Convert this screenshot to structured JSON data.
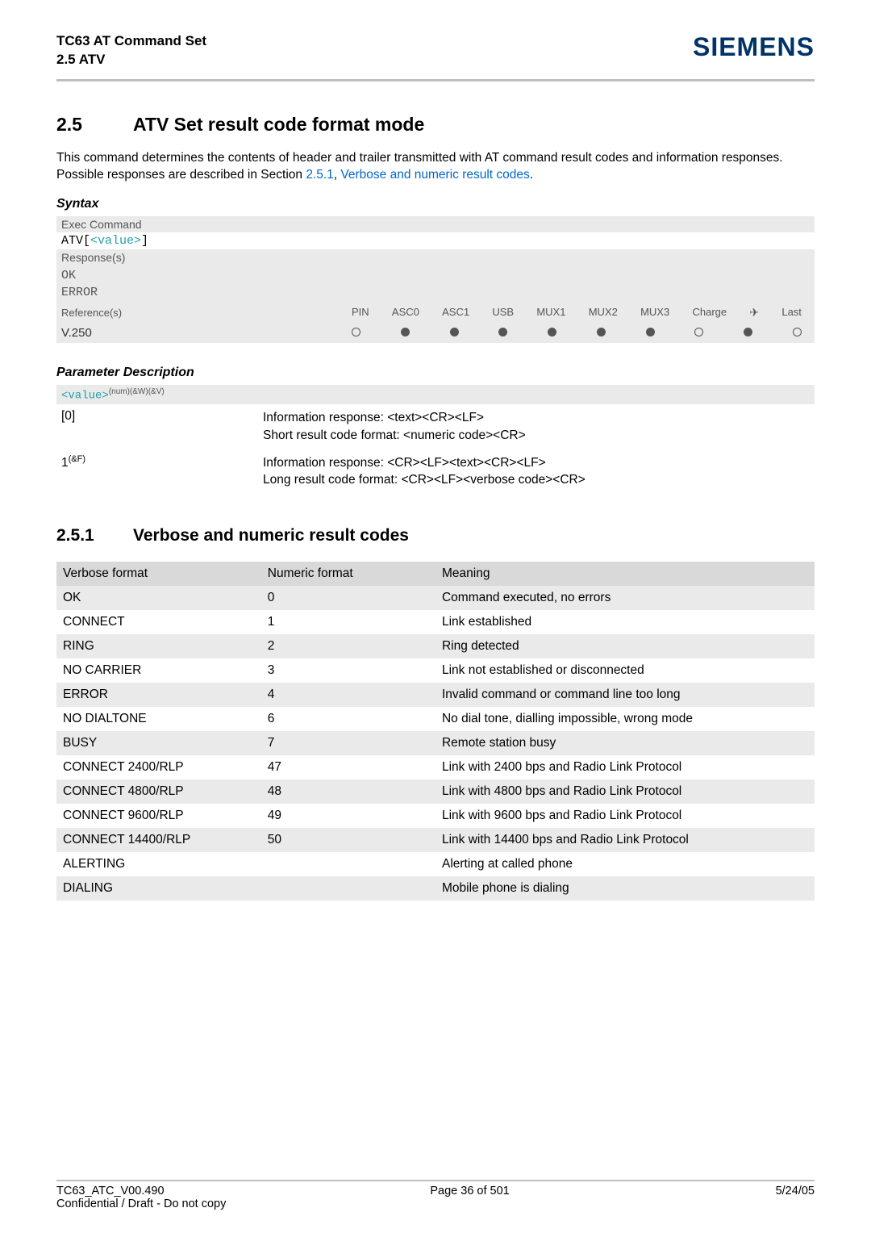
{
  "header": {
    "title": "TC63 AT Command Set",
    "sub": "2.5 ATV",
    "brand": "SIEMENS"
  },
  "section": {
    "num": "2.5",
    "title": "ATV   Set result code format mode",
    "para_a": "This command determines the contents of header and trailer transmitted with AT command result codes and information responses. Possible responses are described in Section ",
    "para_link1": "2.5.1",
    "para_mid": ", ",
    "para_link2": "Verbose and numeric result codes",
    "para_end": "."
  },
  "syntax": {
    "label": "Syntax",
    "exec": "Exec Command",
    "cmd_pre": "ATV[",
    "cmd_val": "<value>",
    "cmd_post": "]",
    "resp_label": "Response(s)",
    "resp_ok": "OK",
    "resp_err": "ERROR",
    "ref_label": "Reference(s)",
    "ref_cols": [
      "PIN",
      "ASC0",
      "ASC1",
      "USB",
      "MUX1",
      "MUX2",
      "MUX3",
      "Charge",
      "✈",
      "Last"
    ],
    "ref_val": "V.250",
    "ref_dots": [
      "empty",
      "filled",
      "filled",
      "filled",
      "filled",
      "filled",
      "filled",
      "empty",
      "filled",
      "empty"
    ]
  },
  "params": {
    "label": "Parameter Description",
    "hdr_val": "<value>",
    "hdr_sup": "(num)(&W)(&V)",
    "rows": [
      {
        "key": "[0]",
        "lines": [
          "Information response: <text><CR><LF>",
          "Short result code format: <numeric code><CR>"
        ]
      },
      {
        "key": "1",
        "keysup": "(&F)",
        "lines": [
          "Information response: <CR><LF><text><CR><LF>",
          "Long result code format: <CR><LF><verbose code><CR>"
        ]
      }
    ]
  },
  "subsection": {
    "num": "2.5.1",
    "title": "Verbose and numeric result codes"
  },
  "chart_data": {
    "type": "table",
    "columns": [
      "Verbose format",
      "Numeric format",
      "Meaning"
    ],
    "rows": [
      [
        "OK",
        "0",
        "Command executed, no errors"
      ],
      [
        "CONNECT",
        "1",
        "Link established"
      ],
      [
        "RING",
        "2",
        "Ring detected"
      ],
      [
        "NO CARRIER",
        "3",
        "Link not established or disconnected"
      ],
      [
        "ERROR",
        "4",
        "Invalid command or command line too long"
      ],
      [
        "NO DIALTONE",
        "6",
        "No dial tone, dialling impossible, wrong mode"
      ],
      [
        "BUSY",
        "7",
        "Remote station busy"
      ],
      [
        "CONNECT 2400/RLP",
        "47",
        "Link with 2400 bps and Radio Link Protocol"
      ],
      [
        "CONNECT 4800/RLP",
        "48",
        "Link with 4800 bps and Radio Link Protocol"
      ],
      [
        "CONNECT 9600/RLP",
        "49",
        "Link with 9600 bps and Radio Link Protocol"
      ],
      [
        "CONNECT 14400/RLP",
        "50",
        "Link with 14400 bps and Radio Link Protocol"
      ],
      [
        "ALERTING",
        "",
        "Alerting at called phone"
      ],
      [
        "DIALING",
        "",
        "Mobile phone is dialing"
      ]
    ]
  },
  "footer": {
    "left": "TC63_ATC_V00.490",
    "center": "Page 36 of 501",
    "right": "5/24/05",
    "conf": "Confidential / Draft - Do not copy"
  }
}
